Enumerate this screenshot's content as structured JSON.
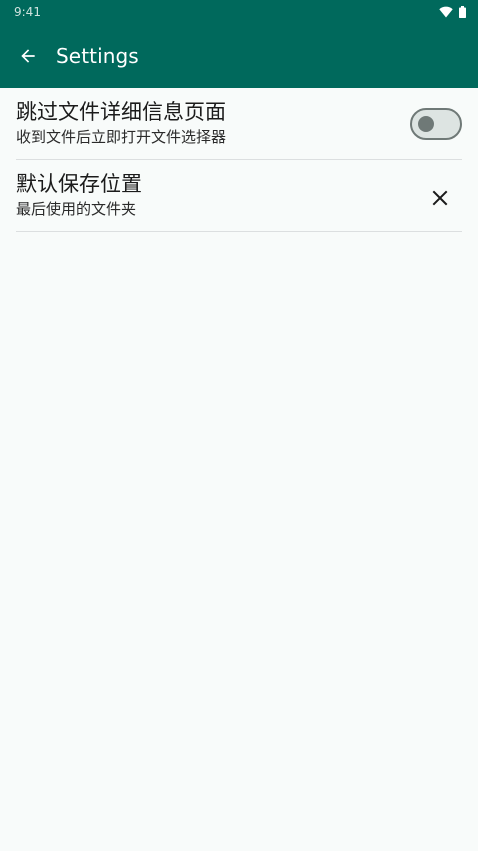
{
  "status_bar": {
    "time": "9:41"
  },
  "app_bar": {
    "title": "Settings",
    "back_icon": "arrow-back-icon",
    "color": "#00695c"
  },
  "settings": [
    {
      "title": "跳过文件详细信息页面",
      "subtitle": "收到文件后立即打开文件选择器",
      "control": "toggle",
      "checked": false
    },
    {
      "title": "默认保存位置",
      "subtitle": "最后使用的文件夹",
      "control": "clear-button",
      "icon": "close-icon"
    }
  ]
}
